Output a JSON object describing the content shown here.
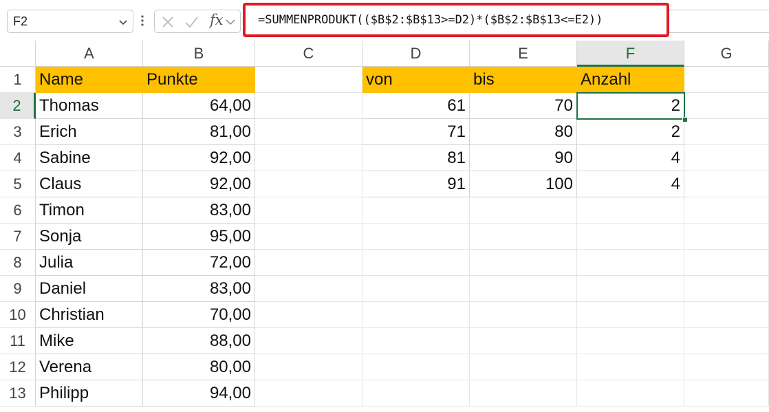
{
  "name_box": {
    "value": "F2"
  },
  "formula_bar": {
    "fx_label": "fx",
    "formula": "=SUMMENPRODUKT(($B$2:$B$13>=D2)*($B$2:$B$13<=E2))"
  },
  "active_cell": "F2",
  "columns": [
    "A",
    "B",
    "C",
    "D",
    "E",
    "F",
    "G"
  ],
  "rows": [
    "1",
    "2",
    "3",
    "4",
    "5",
    "6",
    "7",
    "8",
    "9",
    "10",
    "11",
    "12",
    "13"
  ],
  "table_left": {
    "headers": [
      "Name",
      "Punkte"
    ],
    "rows": [
      [
        "Thomas",
        "64,00"
      ],
      [
        "Erich",
        "81,00"
      ],
      [
        "Sabine",
        "92,00"
      ],
      [
        "Claus",
        "92,00"
      ],
      [
        "Timon",
        "83,00"
      ],
      [
        "Sonja",
        "95,00"
      ],
      [
        "Julia",
        "72,00"
      ],
      [
        "Daniel",
        "83,00"
      ],
      [
        "Christian",
        "70,00"
      ],
      [
        "Mike",
        "88,00"
      ],
      [
        "Verena",
        "80,00"
      ],
      [
        "Philipp",
        "94,00"
      ]
    ]
  },
  "table_right": {
    "headers": [
      "von",
      "bis",
      "Anzahl"
    ],
    "rows": [
      [
        "61",
        "70",
        "2"
      ],
      [
        "71",
        "80",
        "2"
      ],
      [
        "81",
        "90",
        "4"
      ],
      [
        "91",
        "100",
        "4"
      ]
    ]
  },
  "colors": {
    "header_fill": "#ffc000",
    "selection_green": "#1e7145",
    "formula_highlight": "#e01b24"
  }
}
